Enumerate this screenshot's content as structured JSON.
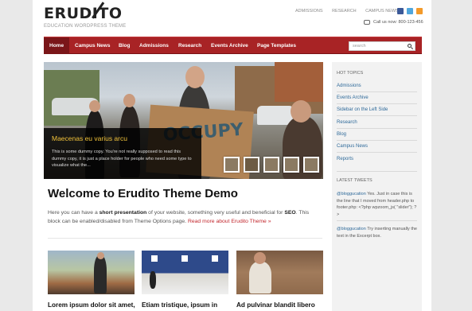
{
  "site": {
    "logo": "ERUDITO",
    "tagline": "EDUCATION WORDPRESS THEME"
  },
  "toplinks": [
    "ADMISSIONS",
    "RESEARCH",
    "CAMPUS NEWS"
  ],
  "contact": {
    "phone": "Call us now: 800-123-456"
  },
  "nav": {
    "items": [
      "Home",
      "Campus News",
      "Blog",
      "Admissions",
      "Research",
      "Events Archive",
      "Page Templates"
    ],
    "active": "Home"
  },
  "search": {
    "placeholder": "search"
  },
  "slider": {
    "sign_text": "OCCUPY",
    "caption_title": "Maecenas eu varius arcu",
    "caption_text": "This is some dummy copy. You're not really supposed to read this dummy copy, it is just a place holder for people who need some type to visualize what the..."
  },
  "welcome": {
    "title": "Welcome to Erudito Theme Demo",
    "text_1": "Here you can have a ",
    "bold_1": "short presentation",
    "text_2": " of your website, something very useful and beneficial for ",
    "bold_2": "SEO",
    "text_3": ". This block can be enabled/disabled from Theme Options page. ",
    "more_link": "Read more about Erudito Theme »"
  },
  "posts": [
    {
      "title": "Lorem ipsum dolor sit amet,"
    },
    {
      "title": "Etiam tristique, ipsum in"
    },
    {
      "title": "Ad pulvinar blandit libero"
    }
  ],
  "sidebar": {
    "hot_topics_heading": "HOT TOPICS",
    "hot_topics": [
      "Admissions",
      "Events Archive",
      "Sidebar on the Left Side",
      "Research",
      "Blog",
      "Campus News",
      "Reports"
    ],
    "latest_tweets_heading": "LATEST TWEETS",
    "tweets": [
      {
        "user": "@bloggucation",
        "text": " Yes. Just in case this is the line that I moved from header.php to footer.php: <?php wpzoom_js( \"slider\"); ?>"
      },
      {
        "user": "@bloggucation",
        "text": " Try inserting manually the text in the Excerpt box."
      }
    ]
  },
  "colors": {
    "nav_red": "#a82325",
    "nav_active": "#7a1619",
    "link_blue": "#2f6a9a",
    "caption_title": "#f0c23a",
    "read_more_red": "#c2272d"
  }
}
